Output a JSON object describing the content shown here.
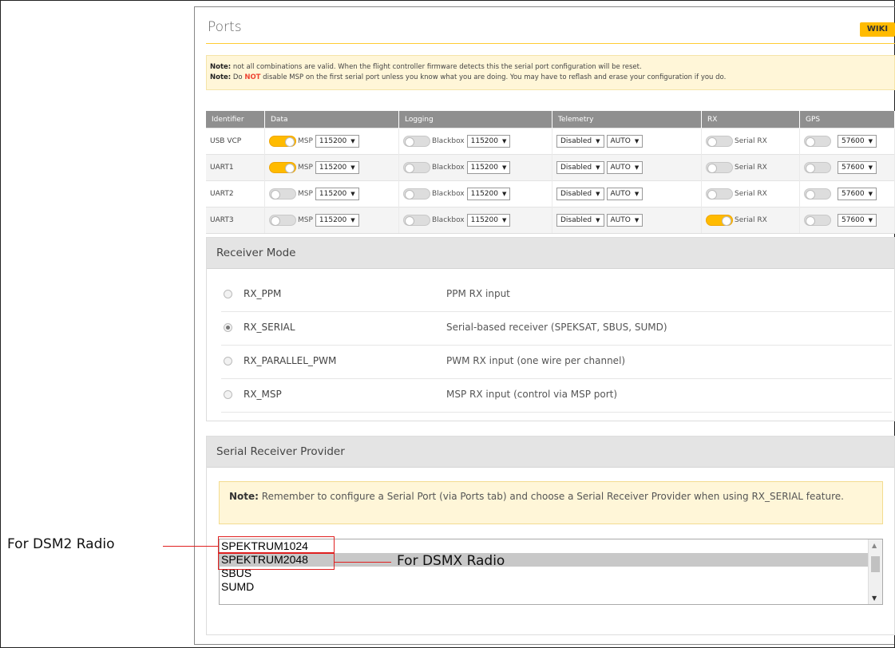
{
  "ports": {
    "title": "Ports",
    "wiki_label": "WIKI",
    "note1_bold": "Note:",
    "note1_text": " not all combinations are valid. When the flight controller firmware detects this the serial port configuration will be reset.",
    "note2_bold": "Note:",
    "note2_pre": " Do ",
    "note2_red": "NOT",
    "note2_post": " disable MSP on the first serial port unless you know what you are doing. You may have to reflash and erase your configuration if you do.",
    "headers": [
      "Identifier",
      "Data",
      "Logging",
      "Telemetry",
      "RX",
      "GPS"
    ],
    "rows": [
      {
        "id": "USB VCP",
        "msp_on": true,
        "msp_label": "MSP",
        "msp_baud": "115200",
        "log_label": "Blackbox",
        "log_baud": "115200",
        "tel": "Disabled",
        "tel_baud": "AUTO",
        "rx_on": false,
        "rx_label": "Serial RX",
        "gps_baud": "57600"
      },
      {
        "id": "UART1",
        "msp_on": true,
        "msp_label": "MSP",
        "msp_baud": "115200",
        "log_label": "Blackbox",
        "log_baud": "115200",
        "tel": "Disabled",
        "tel_baud": "AUTO",
        "rx_on": false,
        "rx_label": "Serial RX",
        "gps_baud": "57600"
      },
      {
        "id": "UART2",
        "msp_on": false,
        "msp_label": "MSP",
        "msp_baud": "115200",
        "log_label": "Blackbox",
        "log_baud": "115200",
        "tel": "Disabled",
        "tel_baud": "AUTO",
        "rx_on": false,
        "rx_label": "Serial RX",
        "gps_baud": "57600"
      },
      {
        "id": "UART3",
        "msp_on": false,
        "msp_label": "MSP",
        "msp_baud": "115200",
        "log_label": "Blackbox",
        "log_baud": "115200",
        "tel": "Disabled",
        "tel_baud": "AUTO",
        "rx_on": true,
        "rx_label": "Serial RX",
        "gps_baud": "57600"
      }
    ]
  },
  "receiver_mode": {
    "title": "Receiver Mode",
    "options": [
      {
        "name": "RX_PPM",
        "desc": "PPM RX input",
        "checked": false
      },
      {
        "name": "RX_SERIAL",
        "desc": "Serial-based receiver (SPEKSAT, SBUS, SUMD)",
        "checked": true
      },
      {
        "name": "RX_PARALLEL_PWM",
        "desc": "PWM RX input (one wire per channel)",
        "checked": false
      },
      {
        "name": "RX_MSP",
        "desc": "MSP RX input (control via MSP port)",
        "checked": false
      }
    ]
  },
  "serial_provider": {
    "title": "Serial Receiver Provider",
    "note_bold": "Note:",
    "note_text": " Remember to configure a Serial Port (via Ports tab) and choose a Serial Receiver Provider when using RX_SERIAL feature.",
    "options": [
      "SPEKTRUM1024",
      "SPEKTRUM2048",
      "SBUS",
      "SUMD"
    ],
    "selected": "SPEKTRUM2048"
  },
  "annotations": {
    "dsm2": "For DSM2 Radio",
    "dsmx": "For DSMX Radio",
    "color": "#e02020"
  },
  "colors": {
    "accent": "#ffbb00",
    "table_header": "#8f8f8f",
    "note_bg": "#fff6d8",
    "section_header": "#e4e4e4"
  }
}
